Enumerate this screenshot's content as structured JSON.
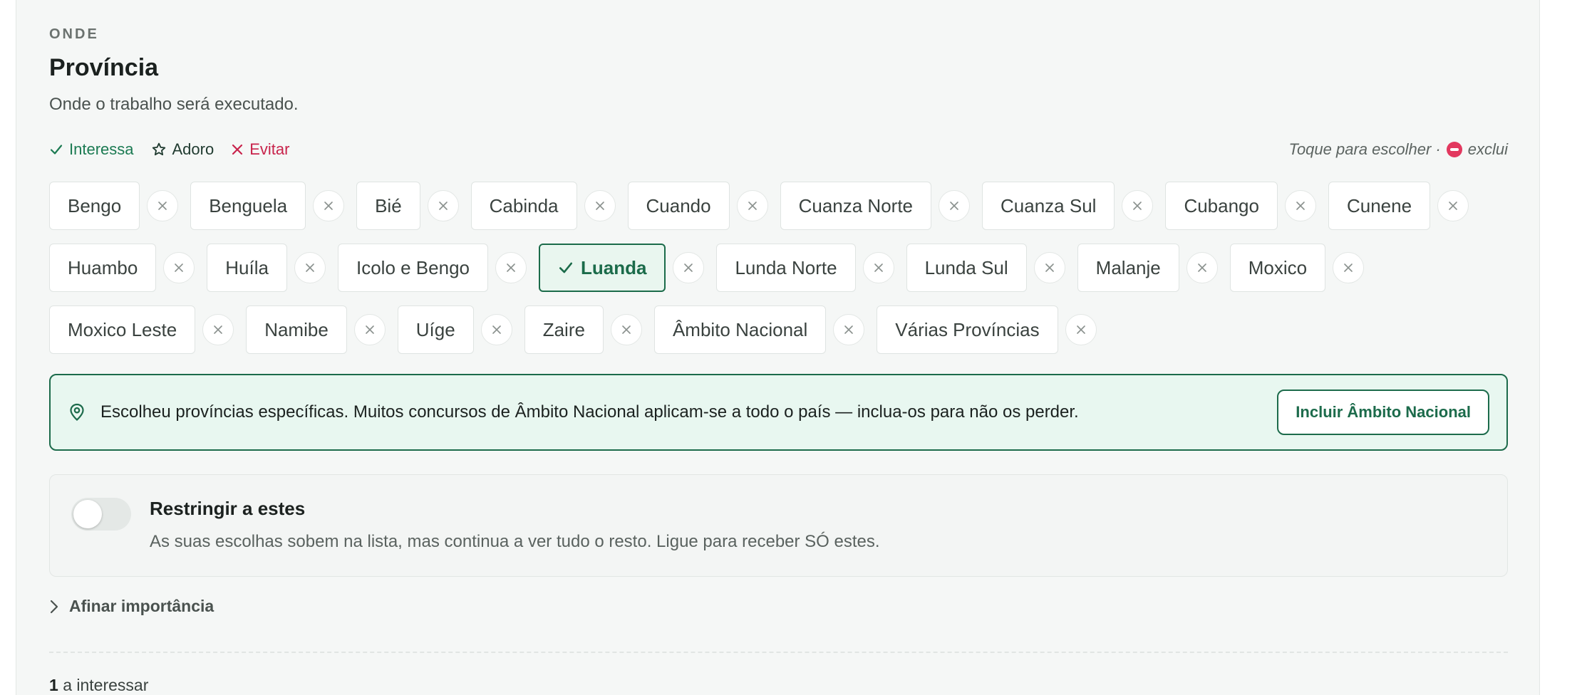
{
  "section": {
    "eyebrow": "ONDE",
    "title": "Província",
    "description": "Onde o trabalho será executado."
  },
  "legend": {
    "interessa": "Interessa",
    "adoro": "Adoro",
    "evitar": "Evitar"
  },
  "hint": {
    "before": "Toque para escolher ·",
    "after": "exclui"
  },
  "provinces": [
    [
      "Bengo",
      "Benguela",
      "Bié",
      "Cabinda",
      "Cuando",
      "Cuanza Norte",
      "Cuanza Sul",
      "Cubango",
      "Cunene"
    ],
    [
      "Huambo",
      "Huíla",
      "Icolo e Bengo",
      "Luanda",
      "Lunda Norte",
      "Lunda Sul",
      "Malanje",
      "Moxico"
    ],
    [
      "Moxico Leste",
      "Namibe",
      "Uíge",
      "Zaire",
      "Âmbito Nacional",
      "Várias Províncias"
    ]
  ],
  "selected": [
    "Luanda"
  ],
  "banner": {
    "text": "Escolheu províncias específicas. Muitos concursos de Âmbito Nacional aplicam-se a todo o país — inclua-os para não os perder.",
    "button": "Incluir Âmbito Nacional"
  },
  "restrict": {
    "title": "Restringir a estes",
    "description": "As suas escolhas sobem na lista, mas continua a ver tudo o resto. Ligue para receber SÓ estes.",
    "enabled": false
  },
  "fine_tune": {
    "label": "Afinar importância"
  },
  "summary": {
    "count": "1",
    "label": "a interessar"
  },
  "colors": {
    "accent": "#1c6b4b",
    "interessa": "#1b7a52",
    "evitar": "#c8234b",
    "exclude_dot": "#e2385f"
  }
}
